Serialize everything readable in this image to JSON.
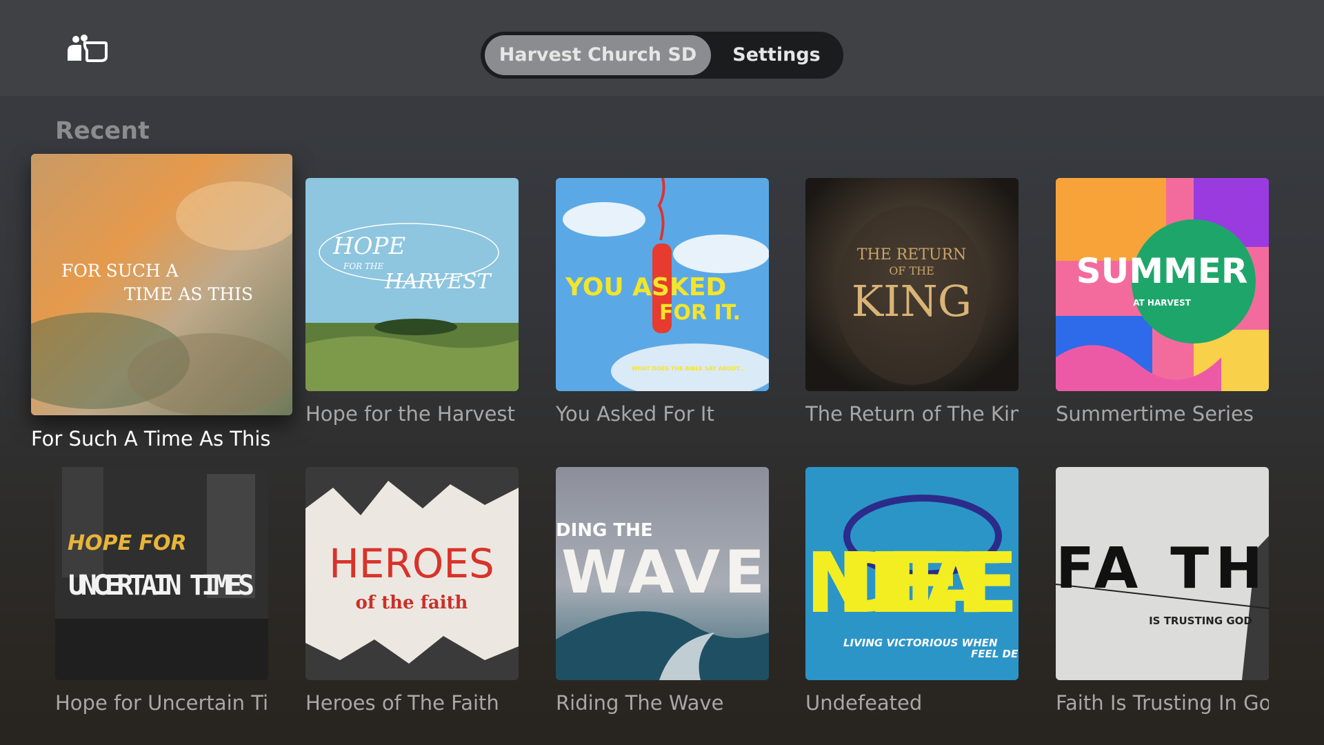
{
  "header": {
    "logo_icon": "app-logo-icon",
    "tabs": [
      {
        "label": "Harvest Church SD",
        "active": true
      },
      {
        "label": "Settings",
        "active": false
      }
    ]
  },
  "section": {
    "title": "Recent"
  },
  "items": [
    {
      "title": "For Such A Time As This",
      "art_text": [
        "FOR SUCH A",
        "TIME AS THIS"
      ]
    },
    {
      "title": "Hope for the Harvest",
      "art_text": [
        "HOPE",
        "FOR THE",
        "HARVEST"
      ]
    },
    {
      "title": "You Asked For It",
      "art_text": [
        "YOU ASKED",
        "FOR IT.",
        "WHAT DOES THE BIBLE SAY ABOUT..."
      ]
    },
    {
      "title": "The Return of The King",
      "art_text": [
        "THE RETURN",
        "OF THE",
        "KING"
      ]
    },
    {
      "title": "Summertime Series",
      "art_text": [
        "SUMMER",
        "AT HARVEST"
      ]
    },
    {
      "title": "Hope for Uncertain Times",
      "art_text": [
        "HOPE FOR",
        "UNCERTAIN TIMES"
      ]
    },
    {
      "title": "Heroes of The Faith",
      "art_text": [
        "HEROES",
        "of the faith"
      ]
    },
    {
      "title": "Riding The Wave",
      "art_text": [
        "DING THE",
        "WAVE"
      ]
    },
    {
      "title": "Undefeated",
      "art_text": [
        "NDEFEATE",
        "LIVING VICTORIOUS WHEN",
        "FEEL DEFE"
      ]
    },
    {
      "title": "Faith Is Trusting In God",
      "art_text": [
        "FA TH",
        "IS TRUSTING GOD"
      ]
    }
  ]
}
